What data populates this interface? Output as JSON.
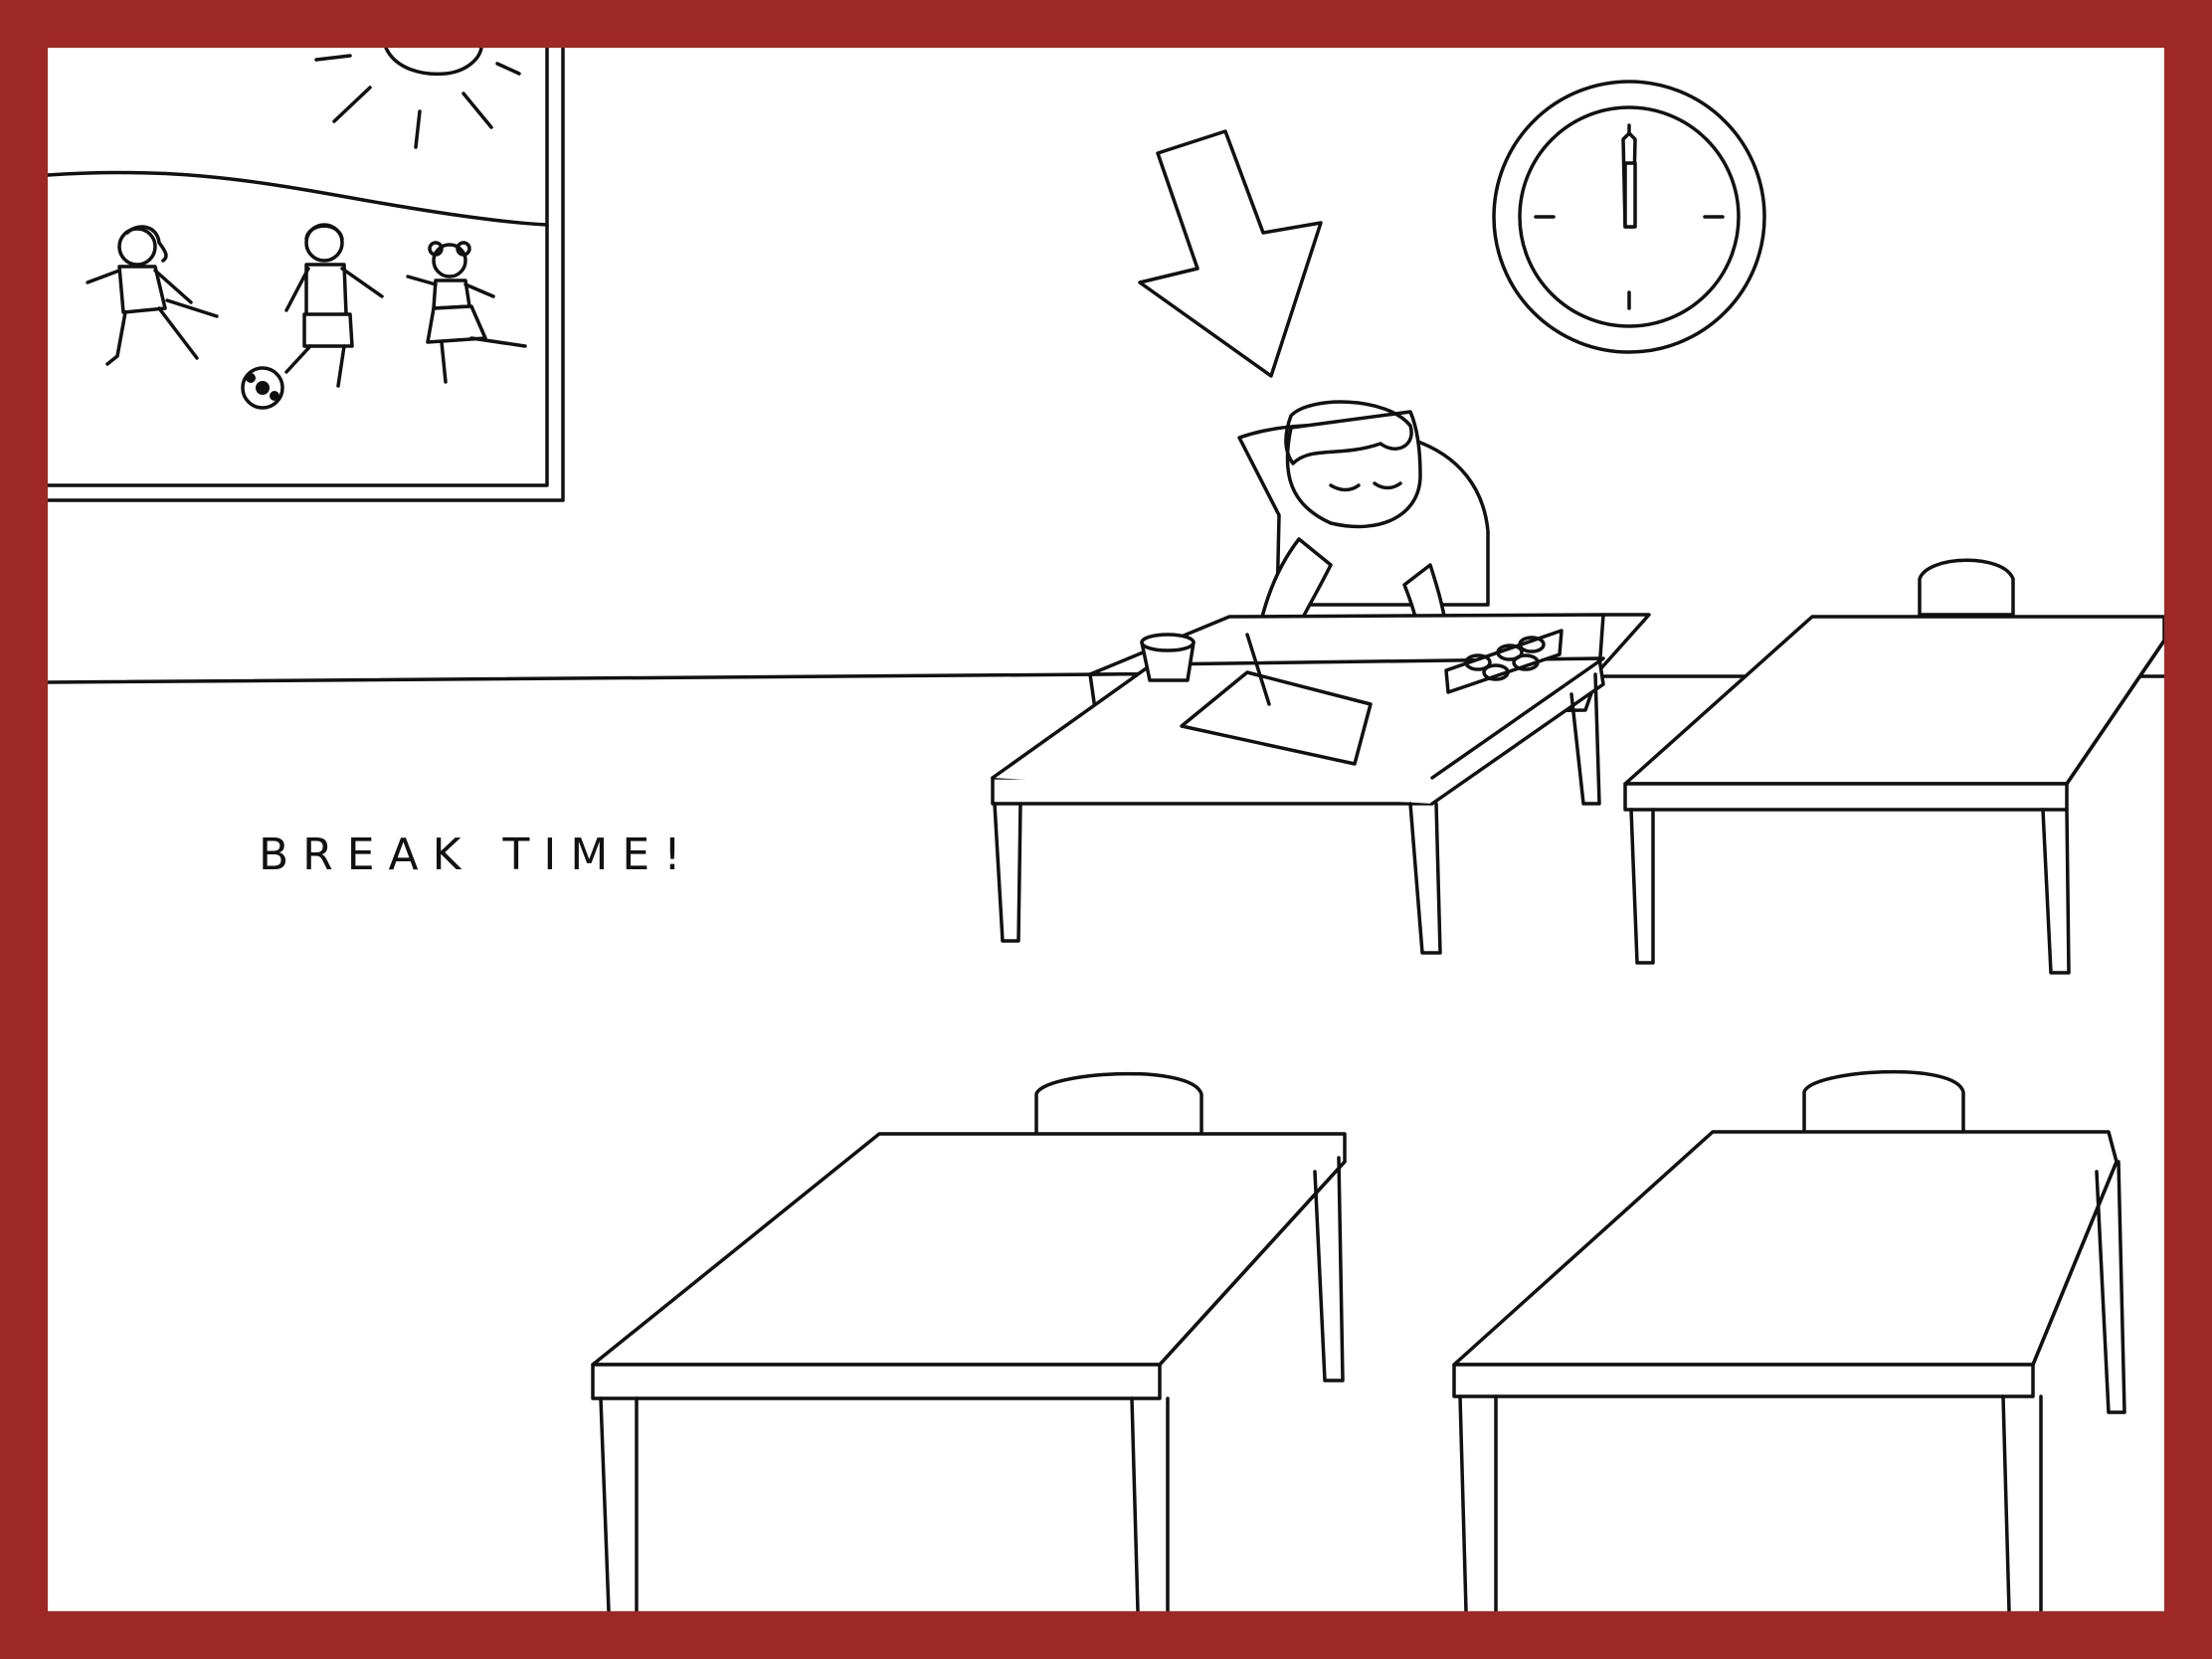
{
  "scene": {
    "caption": "BREAK TIME!",
    "colors": {
      "frame": "#9e2826",
      "background": "#ffffff",
      "ink": "#111111"
    },
    "clock": {
      "hour": 12,
      "minute": 0
    }
  }
}
